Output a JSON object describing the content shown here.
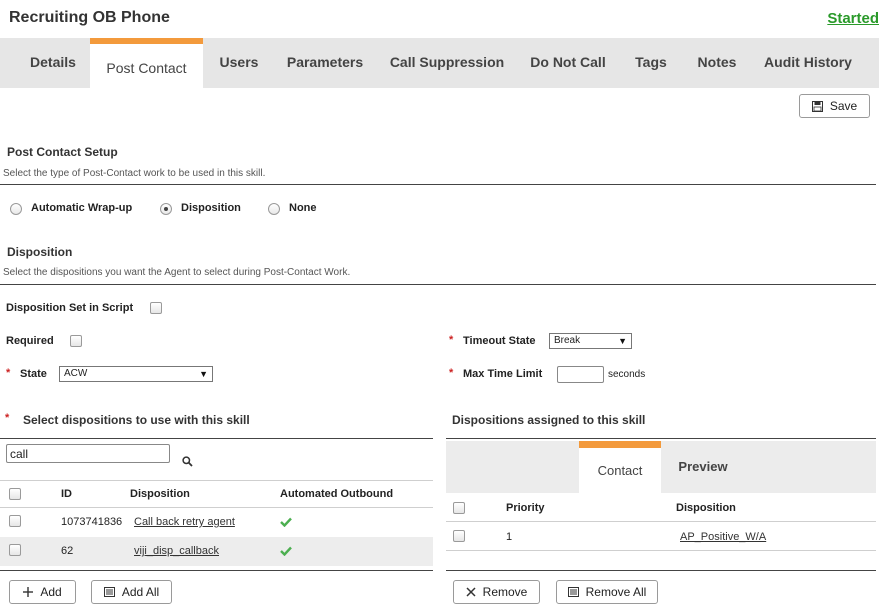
{
  "header": {
    "title": "Recruiting OB Phone",
    "status": "Started"
  },
  "tabs": [
    {
      "label": "Details"
    },
    {
      "label": "Post Contact"
    },
    {
      "label": "Users"
    },
    {
      "label": "Parameters"
    },
    {
      "label": "Call Suppression"
    },
    {
      "label": "Do Not Call"
    },
    {
      "label": "Tags"
    },
    {
      "label": "Notes"
    },
    {
      "label": "Audit History"
    }
  ],
  "active_tab": "Post Contact",
  "toolbar": {
    "save_label": "Save"
  },
  "setup": {
    "title": "Post Contact Setup",
    "desc": "Select the type of Post-Contact work to be used in this skill.",
    "options": [
      "Automatic Wrap-up",
      "Disposition",
      "None"
    ],
    "selected": "Disposition"
  },
  "disposition": {
    "title": "Disposition",
    "desc": "Select the dispositions you want the Agent to select during Post-Contact Work.",
    "set_in_script_label": "Disposition Set in Script",
    "required_label": "Required",
    "state_label": "State",
    "state_value": "ACW",
    "timeout_label": "Timeout State",
    "timeout_value": "Break",
    "max_time_label": "Max Time Limit",
    "max_time_value": "",
    "seconds_label": "seconds"
  },
  "left_panel": {
    "title": "Select dispositions to use with this skill",
    "search_value": "call",
    "columns": {
      "id": "ID",
      "disposition": "Disposition",
      "automated": "Automated Outbound"
    },
    "rows": [
      {
        "id": "1073741836",
        "disposition": "Call back retry agent",
        "automated": "check-icon"
      },
      {
        "id": "62",
        "disposition": "viji_disp_callback",
        "automated": "check-icon"
      }
    ],
    "add_label": "Add",
    "add_all_label": "Add All"
  },
  "right_panel": {
    "title": "Dispositions assigned to this skill",
    "subtabs": [
      {
        "label": "Contact"
      },
      {
        "label": "Preview"
      }
    ],
    "active_subtab": "Contact",
    "columns": {
      "priority": "Priority",
      "disposition": "Disposition"
    },
    "rows": [
      {
        "priority": "1",
        "disposition": "AP_Positive_W/A"
      }
    ],
    "remove_label": "Remove",
    "remove_all_label": "Remove All"
  },
  "colors": {
    "accent": "#f39a3c",
    "status_green": "#2a9a2a",
    "tab_bg": "#e6e6e6",
    "check_green": "#4caf50"
  }
}
